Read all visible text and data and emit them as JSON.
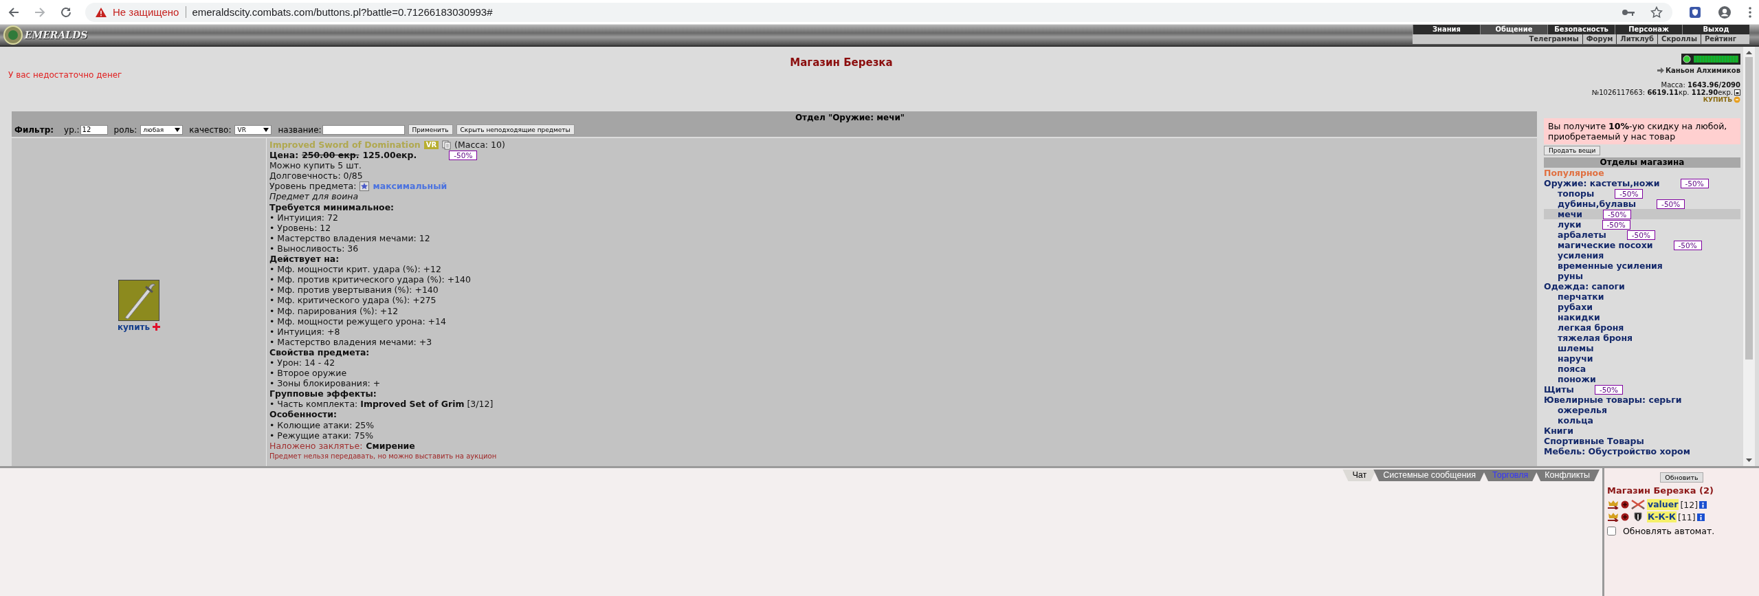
{
  "browser": {
    "security_label": "Не защищено",
    "url": "emeraldscity.combats.com/buttons.pl?battle=0.71266183030993#"
  },
  "header": {
    "logo": "EMERALDS",
    "nav_tabs": [
      {
        "label": "Знания",
        "selected": false
      },
      {
        "label": "Общение",
        "selected": true
      },
      {
        "label": "Безопасность",
        "selected": false
      },
      {
        "label": "Персонаж",
        "selected": false
      },
      {
        "label": "Выход",
        "selected": false
      }
    ],
    "nav_links": [
      "Телеграммы",
      "Форум",
      "Литклуб",
      "Скроллы",
      "Рейтинг"
    ]
  },
  "shop": {
    "title": "Магазин Березка",
    "warning": "У вас недостаточно денег"
  },
  "location": {
    "name": "Каньон Алхимиков",
    "mass": "Масса: **1643.96/2090**",
    "account": "№1026117663: **6619.11**кр. **112.90**екр.",
    "buy": "КУПИТЬ"
  },
  "department": {
    "title": "Отдел \"Оружие: мечи\"",
    "filter": {
      "label": "Фильтр:",
      "level_label": "ур.:",
      "level": "12",
      "role_label": "роль:",
      "role": "любая",
      "quality_label": "качество:",
      "quality": "VR",
      "name_label": "название:",
      "apply": "Применить",
      "hide": "Скрыть неподходящие предметы"
    }
  },
  "item": {
    "name": "Improved Sword of Domination",
    "grade": "VR",
    "mass": "(Масса: 10)",
    "price_label": "Цена:",
    "old_price": "250.00 екр.",
    "price": "125.00екр.",
    "discount": "-50%",
    "buy": "купить",
    "lines": [
      {
        "kind": "text",
        "text": "Можно купить 5 шт."
      },
      {
        "kind": "text",
        "text": "Долговечность: 0/85"
      },
      {
        "kind": "level",
        "text": "Уровень предмета:",
        "value": "максимальный"
      },
      {
        "kind": "italic",
        "text": "Предмет для воина"
      },
      {
        "kind": "heading",
        "text": "Требуется минимальное:"
      },
      {
        "kind": "text",
        "text": "• Интуиция: 72"
      },
      {
        "kind": "text",
        "text": "• Уровень: 12"
      },
      {
        "kind": "text",
        "text": "• Мастерство владения мечами: 12"
      },
      {
        "kind": "text",
        "text": "• Выносливость: 36"
      },
      {
        "kind": "heading",
        "text": "Действует на:"
      },
      {
        "kind": "text",
        "text": "• Мф. мощности крит. удара (%): +12"
      },
      {
        "kind": "text",
        "text": "• Мф. против критического удара (%): +140"
      },
      {
        "kind": "text",
        "text": "• Мф. против увертывания (%): +140"
      },
      {
        "kind": "text",
        "text": "• Мф. критического удара (%): +275"
      },
      {
        "kind": "text",
        "text": "• Мф. парирования (%): +12"
      },
      {
        "kind": "text",
        "text": "• Мф. мощности режущего урона: +14"
      },
      {
        "kind": "text",
        "text": "• Интуиция: +8"
      },
      {
        "kind": "text",
        "text": "• Мастерство владения мечами: +3"
      },
      {
        "kind": "heading",
        "text": "Свойства предмета:"
      },
      {
        "kind": "text",
        "text": "• Урон: 14 - 42"
      },
      {
        "kind": "text",
        "text": "• Второе оружие"
      },
      {
        "kind": "text",
        "text": "• Зоны блокирования: +"
      },
      {
        "kind": "heading",
        "text": "Групповые эффекты:"
      },
      {
        "kind": "text",
        "text": "• Часть комплекта: **Improved Set of Grim** [3/12]"
      },
      {
        "kind": "heading",
        "text": "Особенности:"
      },
      {
        "kind": "text",
        "text": "• Колющие атаки: 25%"
      },
      {
        "kind": "text",
        "text": "• Режущие атаки: 75%"
      },
      {
        "kind": "spell",
        "text": "Наложено заклятье:",
        "value": "Смирение"
      },
      {
        "kind": "note",
        "text": "Предмет нельзя передавать, но можно выставить на аукцион"
      }
    ]
  },
  "promo": "Вы получите **10%**-ую скидку на любой, приобретаемый у нас товар",
  "sell_button": "Продать вещи",
  "departments": {
    "title": "Отделы магазина",
    "items": [
      {
        "label": "Популярное",
        "kind": "popular",
        "selected": false
      },
      {
        "label": "Оружие: кастеты,ножи",
        "kind": "group",
        "selected": false,
        "discount": "-50%",
        "children": [
          {
            "label": "топоры",
            "kind": "group",
            "selected": false,
            "discount": "-50%"
          },
          {
            "label": "дубины,булавы",
            "kind": "group",
            "selected": false,
            "discount": "-50%"
          },
          {
            "label": "мечи",
            "kind": "group",
            "selected": true,
            "discount": "-50%"
          },
          {
            "label": "луки",
            "kind": "group",
            "selected": false,
            "discount": "-50%"
          },
          {
            "label": "арбалеты",
            "kind": "group",
            "selected": false,
            "discount": "-50%"
          },
          {
            "label": "магические посохи",
            "kind": "group",
            "selected": false,
            "discount": "-50%"
          },
          {
            "label": "усиления",
            "kind": "group",
            "selected": false
          },
          {
            "label": "временные усиления",
            "kind": "group",
            "selected": false
          },
          {
            "label": "руны",
            "kind": "group",
            "selected": false
          }
        ]
      },
      {
        "label": "Одежда: сапоги",
        "kind": "group",
        "selected": false,
        "children": [
          {
            "label": "перчатки",
            "kind": "group",
            "selected": false
          },
          {
            "label": "рубахи",
            "kind": "group",
            "selected": false
          },
          {
            "label": "накидки",
            "kind": "group",
            "selected": false
          },
          {
            "label": "легкая броня",
            "kind": "group",
            "selected": false
          },
          {
            "label": "тяжелая броня",
            "kind": "group",
            "selected": false
          },
          {
            "label": "шлемы",
            "kind": "group",
            "selected": false
          },
          {
            "label": "наручи",
            "kind": "group",
            "selected": false
          },
          {
            "label": "пояса",
            "kind": "group",
            "selected": false
          },
          {
            "label": "поножи",
            "kind": "group",
            "selected": false
          }
        ]
      },
      {
        "label": "Щиты",
        "kind": "group",
        "selected": false,
        "discount": "-50%"
      },
      {
        "label": "Ювелирные товары: серьги",
        "kind": "group",
        "selected": false,
        "children": [
          {
            "label": "ожерелья",
            "kind": "group",
            "selected": false
          },
          {
            "label": "кольца",
            "kind": "group",
            "selected": false
          }
        ]
      },
      {
        "label": "Книги",
        "kind": "group",
        "selected": false
      },
      {
        "label": "Спортивные Товары",
        "kind": "group",
        "selected": false
      },
      {
        "label": "Мебель: Обустройство хором",
        "kind": "group",
        "selected": false
      }
    ]
  },
  "chat_tabs": [
    {
      "label": "Чат",
      "selected": true,
      "highlighted": false
    },
    {
      "label": "Системные сообщения",
      "selected": false,
      "highlighted": false
    },
    {
      "label": "Торговля",
      "selected": false,
      "highlighted": true
    },
    {
      "label": "Конфликты",
      "selected": false,
      "highlighted": false
    }
  ],
  "online": {
    "refresh": "Обновить",
    "room": "Магазин Березка (2)",
    "users": [
      {
        "name": "valuer",
        "level": "[12]",
        "kind": "swords"
      },
      {
        "name": "К-К-К",
        "level": "[11]",
        "kind": "shield"
      }
    ],
    "auto_refresh": {
      "label": "Обновлять автомат.",
      "checked": false
    }
  }
}
